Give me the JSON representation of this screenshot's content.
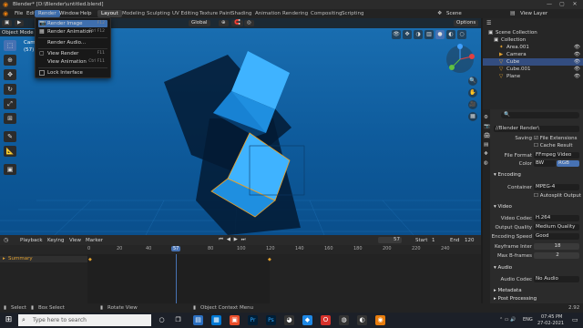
{
  "window": {
    "title": "Blender* [D:\\Blender\\untitled.blend]"
  },
  "menubar": {
    "items": [
      "File",
      "Edit",
      "Render",
      "Window",
      "Help"
    ],
    "workspaces": [
      "Layout",
      "Modeling",
      "Sculpting",
      "UV Editing",
      "Texture Paint",
      "Shading",
      "Animation",
      "Rendering",
      "Compositing",
      "Scripting"
    ],
    "scene": "Scene",
    "view_layer": "View Layer"
  },
  "render_menu": {
    "items": [
      {
        "label": "Render Image",
        "shortcut": "F12"
      },
      {
        "label": "Render Animation",
        "shortcut": "Ctrl F12"
      },
      {
        "label": "Render Audio..."
      },
      {
        "label": "View Render",
        "shortcut": "F11"
      },
      {
        "label": "View Animation",
        "shortcut": "Ctrl F11"
      },
      {
        "label": "Lock Interface"
      }
    ]
  },
  "viewport": {
    "mode": "Object Mode",
    "header_items": [
      "View",
      "Select",
      "Add",
      "Object"
    ],
    "transform": "Global",
    "options": "Options",
    "overlay_text": [
      "Camera Perspective",
      "(57) Collection | Cube"
    ]
  },
  "timeline": {
    "menus": [
      "Playback",
      "Keying",
      "View",
      "Marker"
    ],
    "current_frame": "57",
    "start_label": "Start",
    "start": "1",
    "end_label": "End",
    "end": "120",
    "ticks": [
      "0",
      "20",
      "40",
      "57",
      "80",
      "100",
      "120",
      "140",
      "160",
      "180",
      "200",
      "220",
      "240"
    ],
    "summary": "Summary"
  },
  "outliner": {
    "rows": [
      {
        "label": "Scene Collection",
        "icon": "collection-icon"
      },
      {
        "label": "Collection",
        "icon": "collection-icon"
      },
      {
        "label": "Area.001",
        "icon": "light-icon"
      },
      {
        "label": "Camera",
        "icon": "camera-icon"
      },
      {
        "label": "Cube",
        "icon": "mesh-icon"
      },
      {
        "label": "Cube.001",
        "icon": "mesh-icon"
      },
      {
        "label": "Plane",
        "icon": "mesh-icon"
      }
    ]
  },
  "properties": {
    "path": "//Blender Render\\",
    "saving_label": "Saving",
    "file_ext": "File Extensions",
    "cache": "Cache Result",
    "file_format_label": "File Format",
    "file_format": "FFmpeg Video",
    "color_label": "Color",
    "color_bw": "BW",
    "color_rgb": "RGB",
    "encoding": "Encoding",
    "container_label": "Container",
    "container": "MPEG-4",
    "autosplit": "Autosplit Output",
    "video": "Video",
    "codec_label": "Video Codec",
    "codec": "H.264",
    "quality_label": "Output Quality",
    "quality": "Medium Quality",
    "speed_label": "Encoding Speed",
    "speed": "Good",
    "keyframe_label": "Keyframe Inter",
    "keyframe": "18",
    "bframes_label": "Max B-frames",
    "bframes": "2",
    "audio": "Audio",
    "audio_codec_label": "Audio Codec",
    "audio_codec": "No Audio",
    "metadata": "Metadata",
    "post": "Post Processing"
  },
  "statusbar": {
    "items": [
      "Select",
      "Box Select",
      "Rotate View",
      "Object Context Menu"
    ],
    "version": "2.92"
  },
  "taskbar": {
    "search": "Type here to search",
    "time": "07:45 PM",
    "date": "27-02-2021",
    "lang": "ENG"
  }
}
